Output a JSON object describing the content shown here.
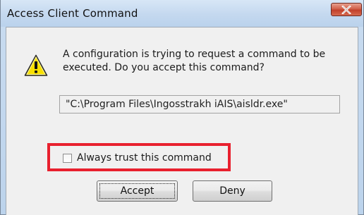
{
  "window": {
    "title": "Access Client Command",
    "close_icon": "close-x-icon"
  },
  "dialog": {
    "icon": "warning-icon",
    "message": "A configuration is trying to request a command to be executed. Do you accept this command?",
    "command_path": "\"C:\\Program Files\\Ingosstrakh iAIS\\aisldr.exe\"",
    "checkbox": {
      "label": "Always trust this command",
      "checked": false
    },
    "buttons": {
      "accept": "Accept",
      "deny": "Deny"
    }
  },
  "colors": {
    "highlight": "#e8202e",
    "titlebar": "#c4d8ef",
    "close_button": "#c2402a",
    "warning_fill": "#f8e000"
  }
}
